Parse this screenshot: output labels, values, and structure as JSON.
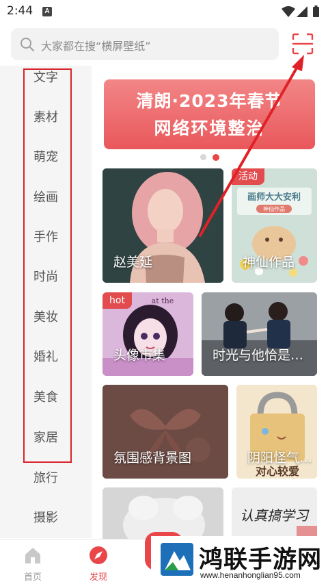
{
  "status_bar": {
    "time": "2:44",
    "notification_badge": "A"
  },
  "search": {
    "placeholder": "大家都在搜“横屏壁纸”"
  },
  "sidebar": {
    "items": [
      {
        "label": "文字"
      },
      {
        "label": "素材"
      },
      {
        "label": "萌宠"
      },
      {
        "label": "绘画"
      },
      {
        "label": "手作"
      },
      {
        "label": "时尚"
      },
      {
        "label": "美妆"
      },
      {
        "label": "婚礼"
      },
      {
        "label": "美食"
      },
      {
        "label": "家居"
      },
      {
        "label": "旅行"
      },
      {
        "label": "摄影"
      }
    ]
  },
  "banner": {
    "line1": "清朗·2023年春节",
    "line2": "网络环境整治",
    "active_dot_index": 1,
    "dot_count": 2
  },
  "cards": [
    {
      "label": "赵美延",
      "tag": ""
    },
    {
      "label": "神仙作品",
      "tag": "活动"
    },
    {
      "label": "头像市集",
      "tag": "hot"
    },
    {
      "label": "时光与他恰是…",
      "tag": ""
    },
    {
      "label": "氛围感背景图",
      "tag": ""
    },
    {
      "label": "阴阳怪气…",
      "tag": ""
    },
    {
      "label": "",
      "tag": ""
    },
    {
      "label": "",
      "tag": ""
    }
  ],
  "card_art_text": {
    "activity_poster": "画师大大安利",
    "activity_subtitle": "神仙作品",
    "poster_corner": "at the",
    "sticker_text": "对心较爱",
    "handwriting": "认真搞学习"
  },
  "bottom_nav": {
    "items": [
      {
        "label": "首页",
        "icon": "home-icon",
        "active": false
      },
      {
        "label": "发现",
        "icon": "compass-icon",
        "active": true
      }
    ]
  },
  "watermark": {
    "title": "鸿联手游网",
    "url": "www.henanhonglian95.com"
  },
  "colors": {
    "accent": "#e9464a",
    "highlight_box": "#d8232a",
    "sidebar_bg": "#f5f5f5",
    "search_bg": "#f2f2f2"
  }
}
